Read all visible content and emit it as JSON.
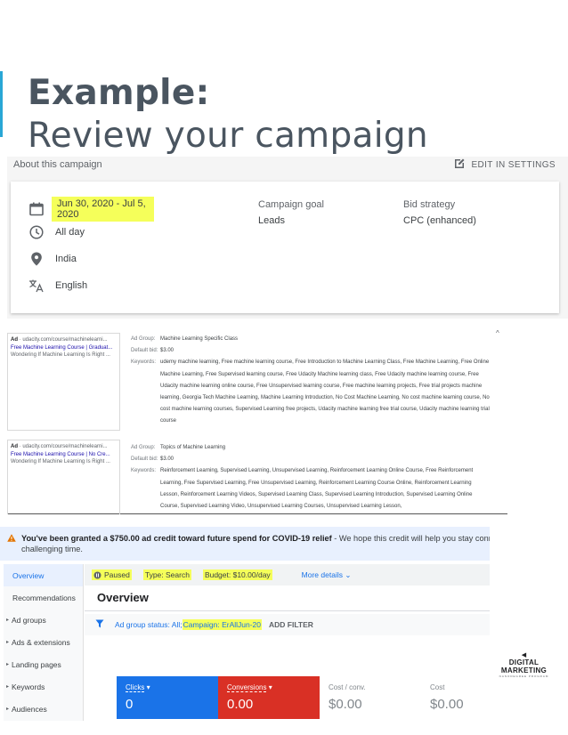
{
  "slide": {
    "title_strong": "Example:",
    "title_sub": "Review your campaign"
  },
  "about": {
    "title": "About this campaign",
    "edit_label": "EDIT IN SETTINGS",
    "dates": "Jun 30, 2020 - Jul 5, 2020",
    "schedule": "All day",
    "location": "India",
    "language": "English",
    "goal_label": "Campaign goal",
    "goal_value": "Leads",
    "bid_label": "Bid strategy",
    "bid_value": "CPC (enhanced)"
  },
  "ads": [
    {
      "ad_badge": "Ad",
      "url": " · udacity.com/course/machinelearni...",
      "headline": "Free Machine Learning Course | Graduat...",
      "description": "Wondering If Machine Learning Is Right ...",
      "ad_group_label": "Ad Group:",
      "ad_group": "Machine Learning Specific Class",
      "bid_label": "Default bid:",
      "bid": "$3.00",
      "keywords_label": "Keywords:",
      "keywords": "udemy machine learning, Free machine learning course, Free Introduction to Machine Learning Class, Free Machine Learning, Free Online Machine Learning, Free Supervised learning course, Free Udacity Machine learning class, Free Udacity machine learning course, Free Udacity machine learning online course, Free Unsupervised learning course, Free machine learning projects, Free trial projects machine learning, Georgia Tech Machine Learning, Machine Learning Introduction, No Cost Machine Learning, No cost machine learning course, No cost machine learning courses, Supervised Learning free projects, Udacity machine learning free trial course, Udacity machine learning trial course"
    },
    {
      "ad_badge": "Ad",
      "url": " · udacity.com/course/machinelearni...",
      "headline": "Free Machine Learning Course | No Cre...",
      "description": "Wondering If Machine Learning Is Right ...",
      "ad_group_label": "Ad Group:",
      "ad_group": "Topics of Machine Learning",
      "bid_label": "Default bid:",
      "bid": "$3.00",
      "keywords_label": "Keywords:",
      "keywords": "Reinforcement Learning, Supervised Learning, Unsupervised Learning, Reinforcement Learning Online Course, Free Reinforcement Learning, Free Supervised Learning, Free Unsupervised Learning, Reinforcement Learning Course Online, Reinforcement Learning Lesson, Reinforcement Learning Videos, Supervised Learning Class, Supervised Learning Introduction, Supervised Learning Online Course, Supervised Learning Video, Unsupervised Learning Courses, Unsupervised Learning Lesson,"
    }
  ],
  "notice": {
    "bold": "You've been granted a $750.00 ad credit toward future spend for COVID-19 relief",
    "rest": " - We hope this credit will help you stay connected with your custo",
    "line2": "challenging time."
  },
  "nav": [
    "Overview",
    "Recommendations",
    "Ad groups",
    "Ads & extensions",
    "Landing pages",
    "Keywords",
    "Audiences"
  ],
  "status_bar": {
    "paused": "Paused",
    "type": "Type: Search",
    "budget": "Budget: $10.00/day",
    "more": "More details"
  },
  "overview_title": "Overview",
  "filter": {
    "prefix": "Ad group status: All; ",
    "campaign": "Campaign: ErAllJun-20",
    "add": "ADD FILTER"
  },
  "logo": {
    "main": "DIGITAL MARKETING",
    "small": "NANODEGREE PROGRAM"
  },
  "metrics": [
    {
      "label": "Clicks",
      "value": "0",
      "bg": "#1a73e8",
      "fg": "#ffffff"
    },
    {
      "label": "Conversions",
      "value": "0.00",
      "bg": "#d93025",
      "fg": "#ffffff"
    },
    {
      "label": "Cost / conv.",
      "value": "$0.00",
      "bg": "#ffffff",
      "fg": "#80868b"
    },
    {
      "label": "Cost",
      "value": "$0.00",
      "bg": "#ffffff",
      "fg": "#80868b"
    }
  ],
  "colors": {
    "accent": "#29a7d6",
    "highlight": "#f5ff5a",
    "google_blue": "#1a73e8",
    "google_red": "#d93025"
  }
}
